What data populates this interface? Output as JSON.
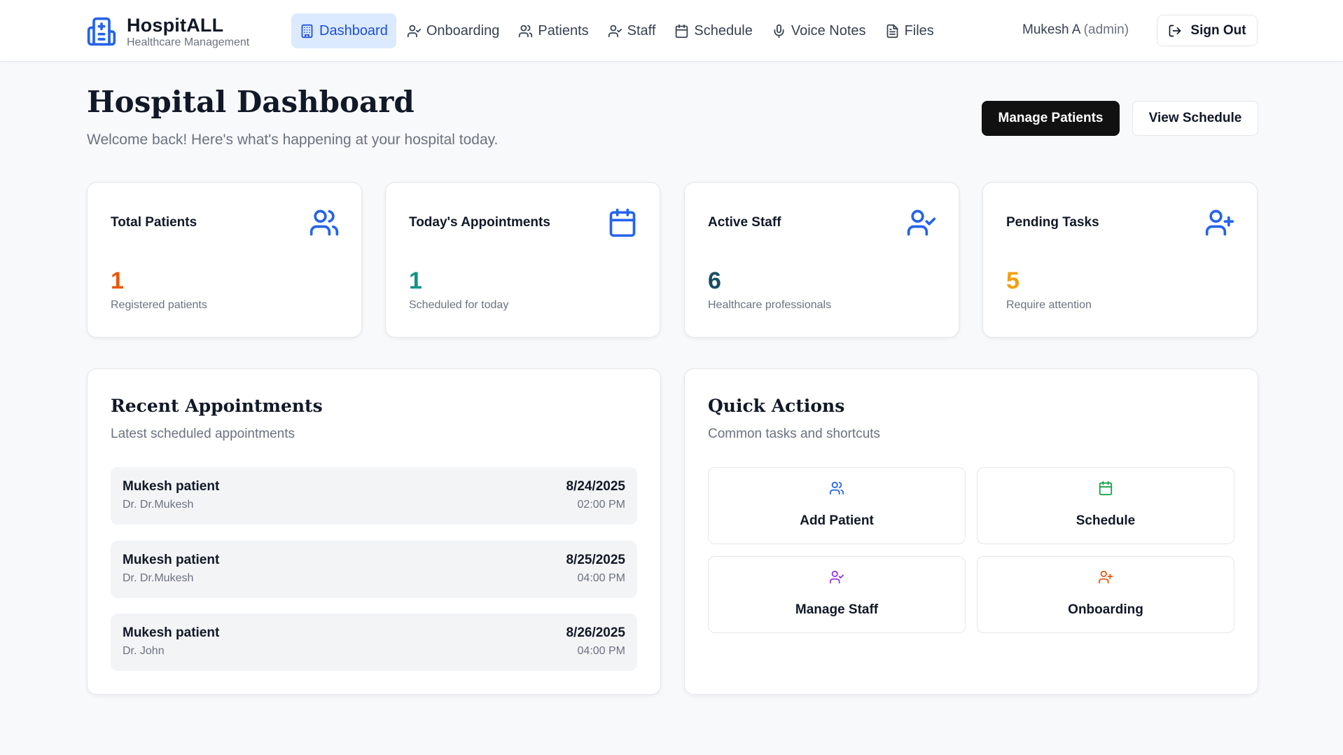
{
  "app": {
    "name": "HospitALL",
    "subtitle": "Healthcare Management"
  },
  "nav": [
    {
      "label": "Dashboard",
      "icon": "building-icon",
      "active": true
    },
    {
      "label": "Onboarding",
      "icon": "user-check-icon"
    },
    {
      "label": "Patients",
      "icon": "users-icon"
    },
    {
      "label": "Staff",
      "icon": "user-check-icon"
    },
    {
      "label": "Schedule",
      "icon": "calendar-icon"
    },
    {
      "label": "Voice Notes",
      "icon": "mic-icon"
    },
    {
      "label": "Files",
      "icon": "file-icon"
    }
  ],
  "user": {
    "name": "Mukesh A",
    "role": "(admin)",
    "signout_label": "Sign Out"
  },
  "page": {
    "title": "Hospital Dashboard",
    "subtitle": "Welcome back! Here's what's happening at your hospital today.",
    "manage_patients_label": "Manage Patients",
    "view_schedule_label": "View Schedule"
  },
  "stats": [
    {
      "label": "Total Patients",
      "value": "1",
      "desc": "Registered patients",
      "color": "#ea580c",
      "icon": "users-icon"
    },
    {
      "label": "Today's Appointments",
      "value": "1",
      "desc": "Scheduled for today",
      "color": "#0d9488",
      "icon": "calendar-icon"
    },
    {
      "label": "Active Staff",
      "value": "6",
      "desc": "Healthcare professionals",
      "color": "#164e63",
      "icon": "user-check-icon"
    },
    {
      "label": "Pending Tasks",
      "value": "5",
      "desc": "Require attention",
      "color": "#f59e0b",
      "icon": "user-plus-icon"
    }
  ],
  "recent": {
    "title": "Recent Appointments",
    "subtitle": "Latest scheduled appointments",
    "items": [
      {
        "patient": "Mukesh patient",
        "doctor": "Dr. Dr.Mukesh",
        "date": "8/24/2025",
        "time": "02:00 PM"
      },
      {
        "patient": "Mukesh patient",
        "doctor": "Dr. Dr.Mukesh",
        "date": "8/25/2025",
        "time": "04:00 PM"
      },
      {
        "patient": "Mukesh patient",
        "doctor": "Dr. John",
        "date": "8/26/2025",
        "time": "04:00 PM"
      }
    ]
  },
  "quick": {
    "title": "Quick Actions",
    "subtitle": "Common tasks and shortcuts",
    "actions": [
      {
        "label": "Add Patient",
        "icon": "users-icon",
        "color": "#2563eb"
      },
      {
        "label": "Schedule",
        "icon": "calendar-icon",
        "color": "#16a34a"
      },
      {
        "label": "Manage Staff",
        "icon": "user-check-icon",
        "color": "#9333ea"
      },
      {
        "label": "Onboarding",
        "icon": "user-plus-icon",
        "color": "#ea580c"
      }
    ]
  }
}
